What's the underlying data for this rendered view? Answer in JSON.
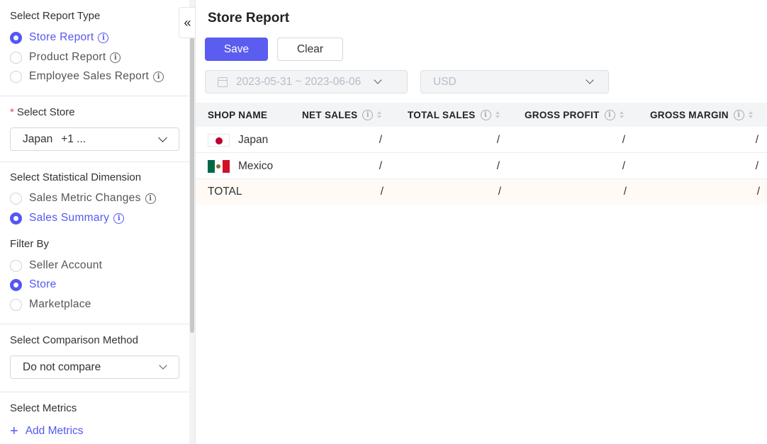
{
  "sidebar": {
    "report_type": {
      "title": "Select Report Type",
      "options": [
        {
          "label": "Store Report",
          "selected": true
        },
        {
          "label": "Product Report",
          "selected": false
        },
        {
          "label": "Employee Sales Report",
          "selected": false
        }
      ]
    },
    "store": {
      "required_mark": "*",
      "title": "Select Store",
      "value": "Japan",
      "more": "+1 ..."
    },
    "dimension": {
      "title": "Select Statistical Dimension",
      "options": [
        {
          "label": "Sales Metric Changes",
          "selected": false
        },
        {
          "label": "Sales Summary",
          "selected": true
        }
      ]
    },
    "filter_by": {
      "title": "Filter By",
      "options": [
        {
          "label": "Seller Account",
          "selected": false
        },
        {
          "label": "Store",
          "selected": true
        },
        {
          "label": "Marketplace",
          "selected": false
        }
      ]
    },
    "comparison": {
      "title": "Select Comparison Method",
      "value": "Do not compare"
    },
    "metrics": {
      "title": "Select Metrics",
      "add_label": "Add Metrics"
    },
    "collapse_icon": "double-chevron-left-icon"
  },
  "main": {
    "title": "Store Report",
    "save_label": "Save",
    "clear_label": "Clear",
    "date_range": "2023-05-31 ~ 2023-06-06",
    "currency": "USD",
    "table": {
      "columns": [
        "SHOP NAME",
        "NET SALES",
        "TOTAL SALES",
        "GROSS PROFIT",
        "GROSS MARGIN"
      ],
      "rows": [
        {
          "shop": "Japan",
          "flag": "japan-flag",
          "net_sales": "/",
          "total_sales": "/",
          "gross_profit": "/",
          "gross_margin": "/"
        },
        {
          "shop": "Mexico",
          "flag": "mexico-flag",
          "net_sales": "/",
          "total_sales": "/",
          "gross_profit": "/",
          "gross_margin": "/"
        }
      ],
      "total": {
        "label": "TOTAL",
        "net_sales": "/",
        "total_sales": "/",
        "gross_profit": "/",
        "gross_margin": "/"
      }
    }
  },
  "colors": {
    "accent": "#5557f2",
    "save_button": "#5b5cf0",
    "required": "#e5484d",
    "total_row_bg": "#fffaf5"
  }
}
